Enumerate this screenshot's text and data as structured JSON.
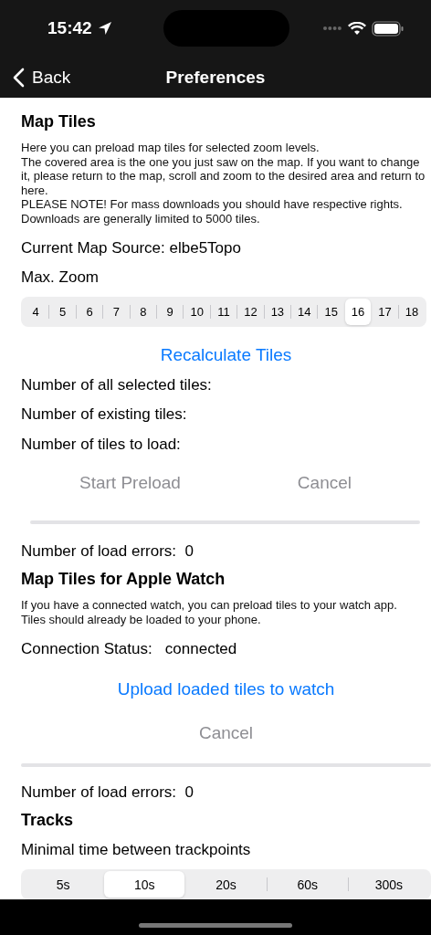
{
  "status_bar": {
    "time": "15:42"
  },
  "nav_bar": {
    "back": "Back",
    "title": "Preferences"
  },
  "map_tiles": {
    "heading": "Map Tiles",
    "description": [
      "Here you can preload map tiles for selected zoom levels.",
      "The covered area is the one you just saw on the map. If you want to change it, please return to the map, scroll and zoom to the desired area and return to here.",
      "PLEASE NOTE! For mass downloads you should have respective rights.",
      "Downloads are generally limited to 5000 tiles."
    ],
    "map_source": "Current Map Source: elbe5Topo",
    "max_zoom_label": "Max. Zoom",
    "zoom_levels": [
      {
        "label": "4",
        "selected": false
      },
      {
        "label": "5",
        "selected": false
      },
      {
        "label": "6",
        "selected": false
      },
      {
        "label": "7",
        "selected": false
      },
      {
        "label": "8",
        "selected": false
      },
      {
        "label": "9",
        "selected": false
      },
      {
        "label": "10",
        "selected": false
      },
      {
        "label": "11",
        "selected": false
      },
      {
        "label": "12",
        "selected": false
      },
      {
        "label": "13",
        "selected": false
      },
      {
        "label": "14",
        "selected": false
      },
      {
        "label": "15",
        "selected": false
      },
      {
        "label": "16",
        "selected": true
      },
      {
        "label": "17",
        "selected": false
      },
      {
        "label": "18",
        "selected": false
      }
    ],
    "recalculate": {
      "label": "Recalculate Tiles",
      "disabled": false
    },
    "counts": [
      "Number of all selected tiles:",
      "Number of existing tiles:",
      "Number of tiles to load:"
    ],
    "actions": [
      {
        "label": "Start Preload",
        "disabled": true
      },
      {
        "label": "Cancel",
        "disabled": true
      }
    ],
    "progress": {
      "level": 0
    },
    "errors": {
      "label": "Number of load errors:",
      "value": "0"
    }
  },
  "watch": {
    "heading": "Map Tiles for Apple Watch",
    "description": [
      "If you have a connected watch, you can preload tiles to your watch app.",
      "Tiles should already be loaded to your phone."
    ],
    "status_label": "Connection Status:",
    "status_value": "connected",
    "upload": {
      "label": "Upload loaded tiles to watch",
      "disabled": false
    },
    "cancel": {
      "label": "Cancel",
      "disabled": true
    },
    "progress": {
      "level": 0
    },
    "errors": {
      "label": "Number of load errors:",
      "value": "0"
    }
  },
  "tracks": {
    "heading": "Tracks",
    "interval_label": "Minimal time between trackpoints",
    "intervals": [
      {
        "label": "5s",
        "selected": false
      },
      {
        "label": "10s",
        "selected": true
      },
      {
        "label": "20s",
        "selected": false
      },
      {
        "label": "60s",
        "selected": false
      },
      {
        "label": "300s",
        "selected": false
      }
    ]
  }
}
